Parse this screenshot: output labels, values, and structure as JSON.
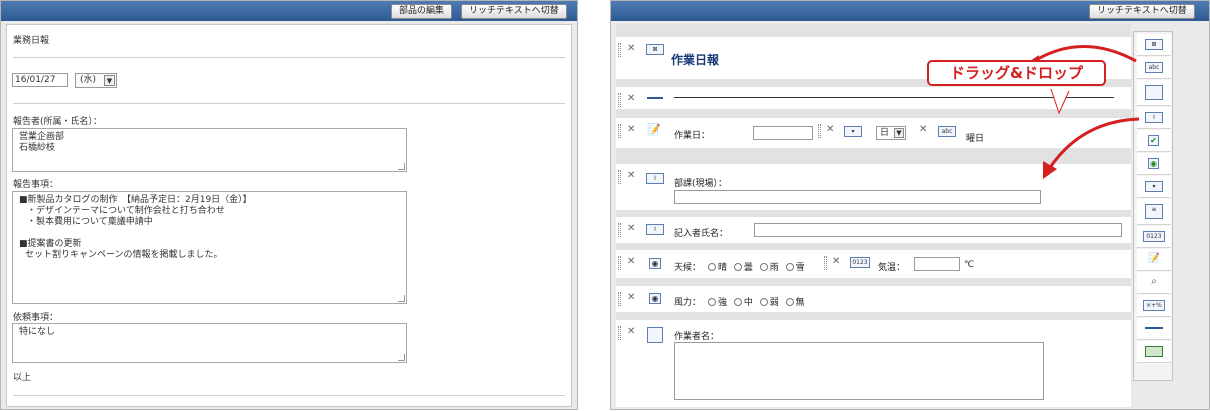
{
  "left": {
    "toolbar": {
      "edit_parts": "部品の編集",
      "richtext": "リッチテキストへ切替"
    },
    "title": "業務日報",
    "date_value": "16/01/27",
    "weekday_value": "(水)",
    "reporter_label": "報告者(所属・氏名）：",
    "reporter_lines": [
      "営業企画部",
      "石橋紗枝"
    ],
    "report_label": "報告事項：",
    "report_lines": [
      "■新製品カタログの制作　【納品予定日：2月19日（金）】",
      "・デザインテーマについて制作会社と打ち合わせ",
      "・製本費用について稟議申請中",
      "",
      "■提案書の更新",
      "セット割りキャンペーンの情報を掲載しました。"
    ],
    "request_label": "依頼事項：",
    "request_value": "特になし",
    "closing": "以上"
  },
  "right": {
    "toolbar": {
      "richtext": "リッチテキストへ切替"
    },
    "title": "作業日報",
    "work_date_label": "作業日：",
    "weekday_value": "日",
    "weekday_suffix": "曜日",
    "dept_label": "部課(現場）：",
    "writer_label": "記入者氏名：",
    "weather_label": "天候：",
    "weather_options": [
      "晴",
      "曇",
      "雨",
      "雪"
    ],
    "temp_label": "気温：",
    "temp_unit": "℃",
    "wind_label": "風力：",
    "wind_options": [
      "強",
      "中",
      "弱",
      "無"
    ],
    "worker_label": "作業者名：",
    "callout": "ドラッグ&ドロップ",
    "icons": {
      "abc": "abc",
      "num": "0123",
      "calc": "×+%"
    }
  },
  "colors": {
    "accent": "#d42020",
    "toolbar": "#3a659f",
    "title": "#1a3a7a"
  }
}
